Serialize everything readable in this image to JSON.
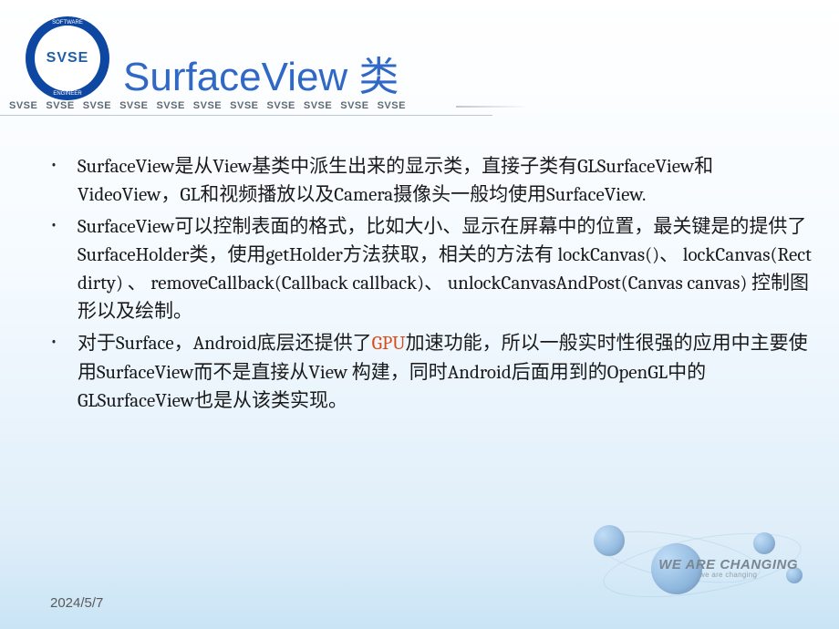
{
  "header": {
    "logo_text": "SVSE",
    "logo_ring_top": "SOFTWARE",
    "logo_ring_bottom": "ENGINEER",
    "title": "SurfaceView 类"
  },
  "svse_band": {
    "items": [
      "SVSE",
      "SVSE",
      "SVSE",
      "SVSE",
      "SVSE",
      "SVSE",
      "SVSE",
      "SVSE",
      "SVSE",
      "SVSE",
      "SVSE"
    ]
  },
  "content": {
    "bullets": [
      {
        "id": "b1",
        "text": "SurfaceView是从View基类中派生出来的显示类，直接子类有GLSurfaceView和VideoView，GL和视频播放以及Camera摄像头一般均使用SurfaceView."
      },
      {
        "id": "b2",
        "text": " SurfaceView可以控制表面的格式，比如大小、显示在屏幕中的位置，最关键是的提供了SurfaceHolder类，使用getHolder方法获取，相关的方法有 lockCanvas()、 lockCanvas(Rect dirty) 、 removeCallback(Callback callback)、 unlockCanvasAndPost(Canvas canvas) 控制图形以及绘制。"
      },
      {
        "id": "b3",
        "pre": "对于Surface，Android底层还提供了",
        "highlight": "GPU",
        "post": "加速功能，所以一般实时性很强的应用中主要使用SurfaceView而不是直接从View 构建，同时Android后面用到的OpenGL中的GLSurfaceView也是从该类实现。"
      }
    ]
  },
  "tagline": {
    "main": "WE ARE CHANGING",
    "sub": "we are changing"
  },
  "footer": {
    "date": "2024/5/7"
  }
}
